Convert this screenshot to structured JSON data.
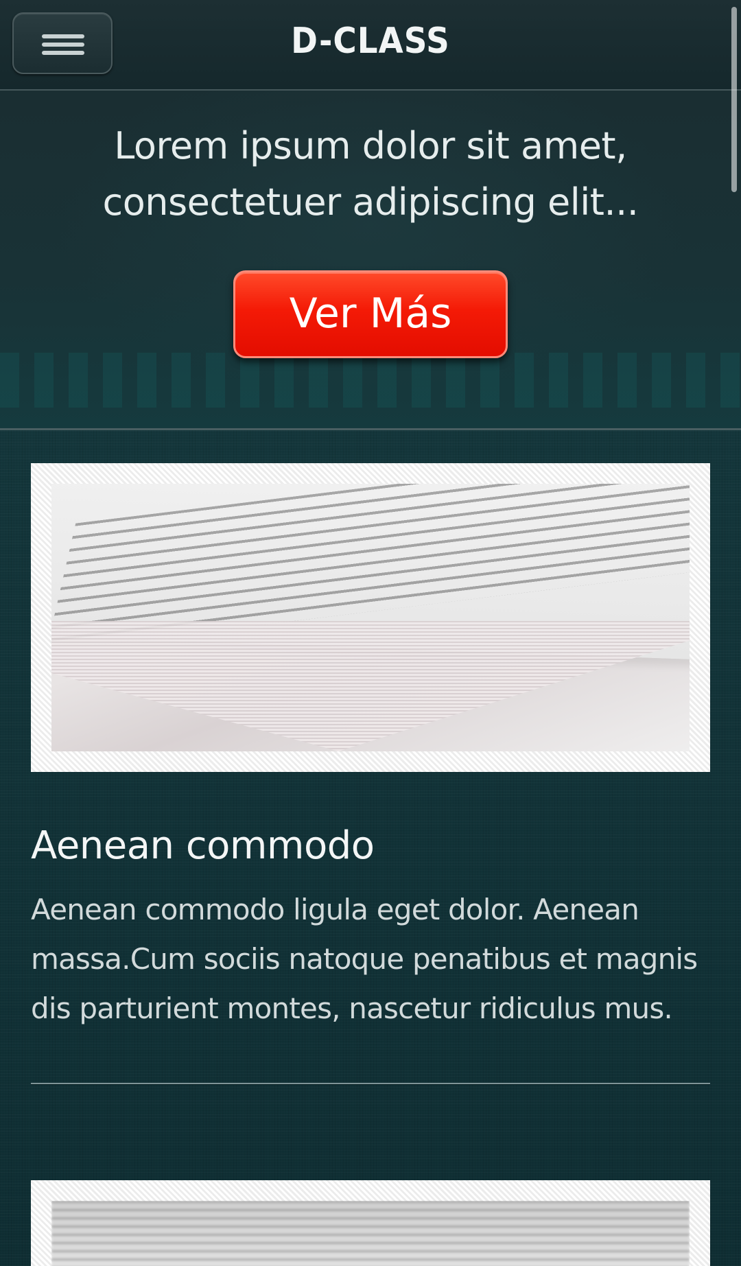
{
  "header": {
    "title": "D-CLASS",
    "menu_icon": "hamburger-icon"
  },
  "hero": {
    "text": "Lorem ipsum dolor sit amet, consectetuer adipiscing elit...",
    "button_label": "Ver Más",
    "button_color": "#f41a06"
  },
  "articles": [
    {
      "image": "stacked-paper-photo",
      "title": "Aenean commodo",
      "body": "Aenean commodo ligula eget dolor. Aenean massa.Cum sociis natoque penatibus et magnis dis parturient montes, nascetur ridiculus mus."
    },
    {
      "image": "newspaper-photo"
    }
  ],
  "colors": {
    "background": "#123338",
    "header": "#1d2f33",
    "accent": "#f41a06"
  }
}
